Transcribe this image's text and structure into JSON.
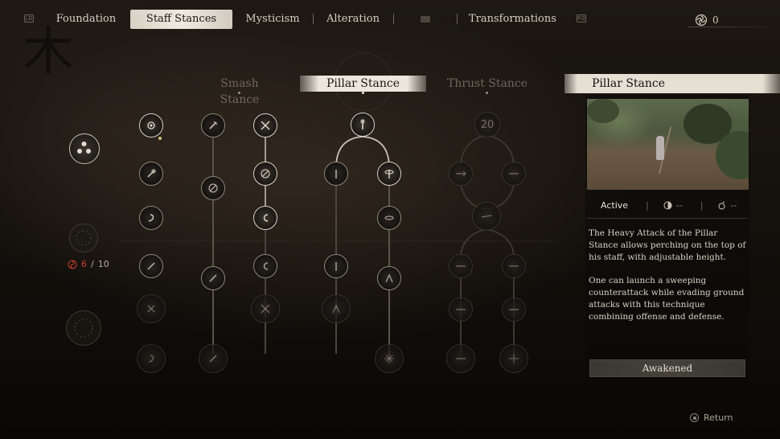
{
  "nav": {
    "left_button": "LB",
    "right_button": "RB",
    "tabs": [
      {
        "label": "Foundation"
      },
      {
        "label": "Staff Stances"
      },
      {
        "label": "Mysticism"
      },
      {
        "label": "Alteration"
      },
      {
        "label": ""
      },
      {
        "label": "Transformations"
      }
    ],
    "active_tab": "Staff Stances",
    "currency_value": "0",
    "currency_icon": "spirit-swirl-icon"
  },
  "stances": {
    "headers": [
      "Smash Stance",
      "Pillar Stance",
      "Thrust Stance"
    ],
    "active": "Pillar Stance",
    "thrust_node_level": "20"
  },
  "left_column": {
    "points_current": "6",
    "points_sep": "/",
    "points_max": "10"
  },
  "detail": {
    "title": "Pillar Stance",
    "status": "Active",
    "stat_a": "--",
    "stat_b": "--",
    "description_1": "The Heavy Attack of the Pillar Stance allows perching on the top of his staff, with adjustable height.",
    "description_2": "One can launch a sweeping counterattack while evading ground attacks with this technique combining offense and defense.",
    "button": "Awakened"
  },
  "footer": {
    "return_label": "Return"
  },
  "colors": {
    "accent_red": "#c9402f",
    "active_tab_bg": "#efe9df",
    "panel_header_bg": "#e5dfd4"
  }
}
